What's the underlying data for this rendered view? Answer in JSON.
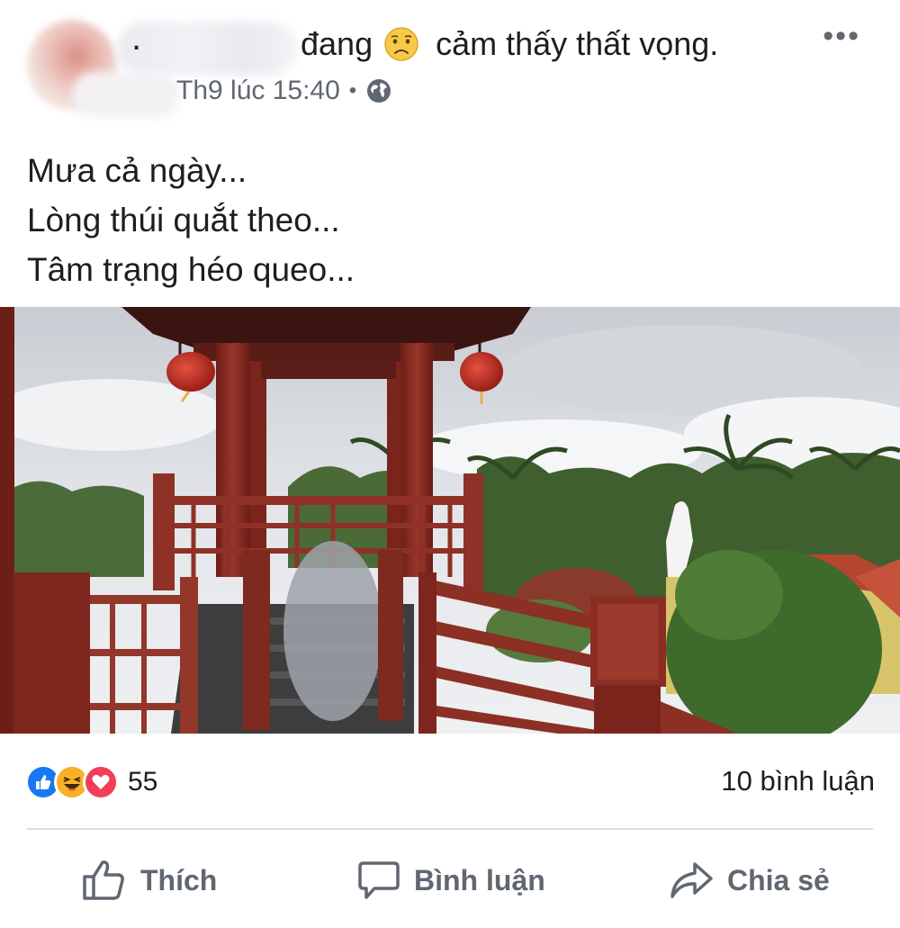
{
  "post": {
    "author_separator": ".",
    "status_prefix": "đang",
    "feeling_icon": "sad-face-emoji",
    "status_suffix": "cảm thấy thất vọng.",
    "more_label": "•••",
    "timestamp": "Th9 lúc 15:40",
    "meta_separator": "•",
    "privacy_icon": "globe-icon",
    "lines": [
      "Mưa cả ngày...",
      "Lòng thúi quắt theo...",
      "Tâm trạng héo queo..."
    ]
  },
  "reactions": {
    "icons": [
      "like-reaction-icon",
      "haha-reaction-icon",
      "love-reaction-icon"
    ],
    "count": "55",
    "comments": "10 bình luận"
  },
  "actions": {
    "like": "Thích",
    "comment": "Bình luận",
    "share": "Chia sẻ"
  },
  "colors": {
    "text": "#1c1e21",
    "muted": "#606770",
    "like_blue": "#1877f2",
    "love_red": "#f33e58",
    "haha_yellow": "#f7b125",
    "pavilion_red": "#8b2a22"
  }
}
